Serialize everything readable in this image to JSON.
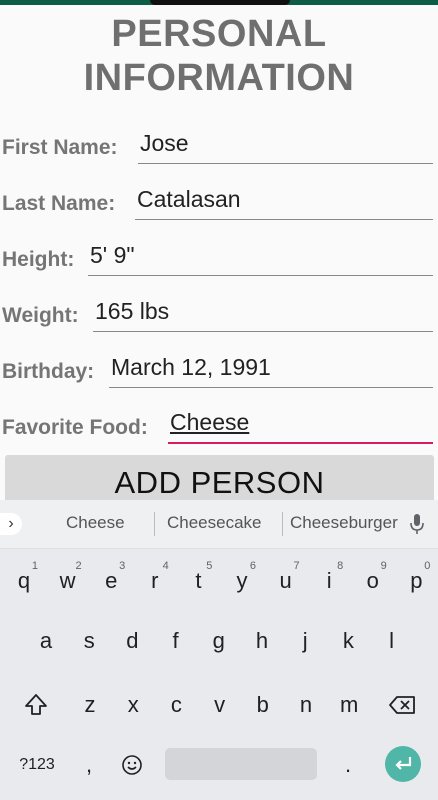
{
  "title": {
    "line1": "PERSONAL",
    "line2": "INFORMATION"
  },
  "fields": [
    {
      "label": "First Name:",
      "value": "Jose"
    },
    {
      "label": "Last Name:",
      "value": "Catalasan"
    },
    {
      "label": "Height:",
      "value": "5' 9\""
    },
    {
      "label": "Weight:",
      "value": "165 lbs"
    },
    {
      "label": "Birthday:",
      "value": "March 12, 1991"
    },
    {
      "label": "Favorite Food:",
      "value": "Cheese"
    }
  ],
  "button": {
    "add_person": "ADD PERSON"
  },
  "keyboard": {
    "suggestions": [
      "Cheese",
      "Cheesecake",
      "Cheeseburger"
    ],
    "row1": [
      "q",
      "w",
      "e",
      "r",
      "t",
      "y",
      "u",
      "i",
      "o",
      "p"
    ],
    "row1_hints": [
      "1",
      "2",
      "3",
      "4",
      "5",
      "6",
      "7",
      "8",
      "9",
      "0"
    ],
    "row2": [
      "a",
      "s",
      "d",
      "f",
      "g",
      "h",
      "j",
      "k",
      "l"
    ],
    "row3": [
      "z",
      "x",
      "c",
      "v",
      "b",
      "n",
      "m"
    ],
    "symbols": "?123",
    "comma": ",",
    "period": "."
  },
  "colors": {
    "accent": "#d81b60",
    "enter": "#4fb6a8",
    "statusbar": "#0d5c45"
  }
}
